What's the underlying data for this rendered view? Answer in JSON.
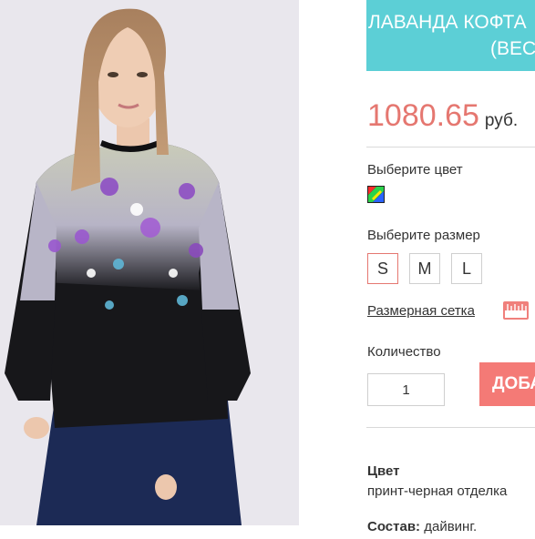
{
  "product": {
    "title_line1": "ЛАВАНДА КОФТА",
    "title_line2": "(ВЕС",
    "price": "1080.65",
    "currency": "руб."
  },
  "options": {
    "color_label": "Выберите цвет",
    "size_label": "Выберите размер",
    "sizes": [
      "S",
      "M",
      "L"
    ],
    "size_chart_link": "Размерная сетка",
    "quantity_label": "Количество",
    "quantity_value": "1",
    "add_button": "ДОБА"
  },
  "details": {
    "color_heading": "Цвет",
    "color_value": "принт-черная отделка",
    "composition_label": "Состав:",
    "composition_value": "дайвинг."
  },
  "colors": {
    "title_bg": "#5ccfd6",
    "price": "#e57770",
    "button": "#f47a76",
    "active_size_border": "#e57770"
  },
  "icons": {
    "color_swatch": "multicolor-swatch-icon",
    "size_chart": "ruler-icon"
  }
}
